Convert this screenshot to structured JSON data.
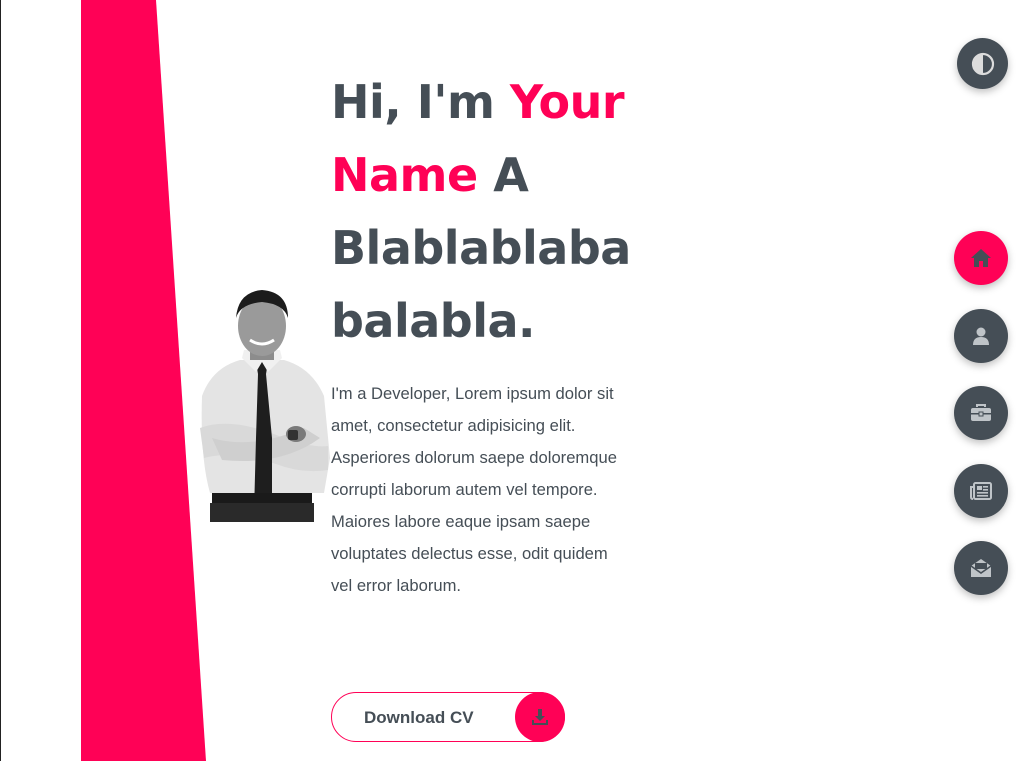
{
  "colors": {
    "accent": "#ff0156",
    "dark": "#454e56",
    "background": "#ffffff"
  },
  "hero": {
    "title_prefix": "Hi, I'm",
    "title_name": "Your Name",
    "title_suffix": "A Blablablaba balabla.",
    "description": "I'm a Developer, Lorem ipsum dolor sit amet, consectetur adipisicing elit. Asperiores dolorum saepe doloremque corrupti laborum autem vel tempore. Maiores labore eaque ipsam saepe voluptates delectus esse, odit quidem vel error laborum.",
    "cv_button_label": "Download CV",
    "cv_icon": "download-icon"
  },
  "theme_toggle": {
    "icon": "half-circle-icon"
  },
  "nav": [
    {
      "icon": "home-icon",
      "active": true
    },
    {
      "icon": "user-icon",
      "active": false
    },
    {
      "icon": "briefcase-icon",
      "active": false
    },
    {
      "icon": "newspaper-icon",
      "active": false
    },
    {
      "icon": "envelope-open-icon",
      "active": false
    }
  ]
}
